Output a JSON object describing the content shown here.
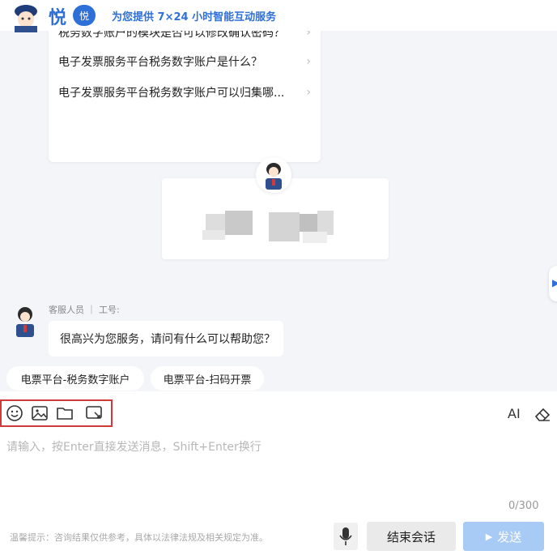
{
  "header": {
    "brand": "悦",
    "badge": "悦",
    "slogan": "为您提供 7×24 小时智能互动服务"
  },
  "faq": [
    {
      "text": "税务数字账户的模块是否可以修改确认密码？"
    },
    {
      "text": "电子发票服务平台税务数字账户是什么？"
    },
    {
      "text": "电子发票服务平台税务数字账户可以归集哪..."
    }
  ],
  "agent": {
    "meta": "客服人员 ｜ 工号:",
    "greeting": "很高兴为您服务，请问有什么可以帮助您？"
  },
  "quick_replies": [
    {
      "label": "电票平台-税务数字账户"
    },
    {
      "label": "电票平台-扫码开票"
    }
  ],
  "composer": {
    "ai_label": "AI",
    "placeholder": "请输入，按Enter直接发送消息，Shift+Enter换行",
    "counter": "0/300",
    "tip": "温馨提示：咨询结果仅供参考，具体以法律法规及相关规定为准。",
    "end_label": "结束会话",
    "send_label": "发送"
  },
  "icons": [
    "emoji-icon",
    "image-icon",
    "folder-icon",
    "screenshot-icon",
    "eraser-icon",
    "microphone-icon",
    "send-arrow-icon",
    "chevron-right-icon"
  ],
  "colors": {
    "accent": "#2f6fd8",
    "highlight_border": "#d23a3a",
    "send_disabled": "#a8cbf5"
  }
}
